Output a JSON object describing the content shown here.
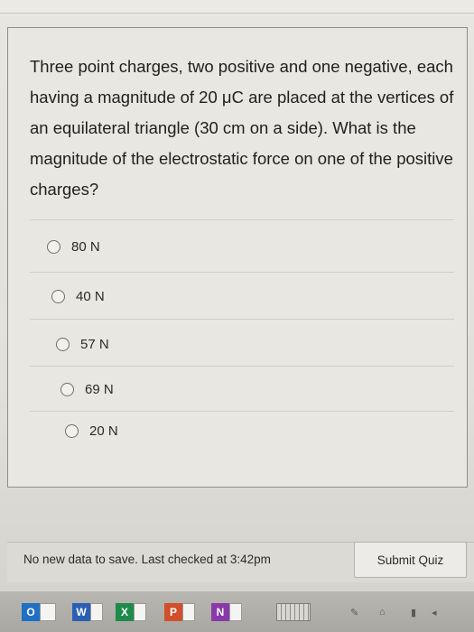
{
  "question": {
    "text": "Three point charges, two positive and one negative, each having a magnitude of 20 μC are placed at the vertices of an equilateral triangle (30 cm on a side). What is the magnitude of the electrostatic force on one of the positive charges?"
  },
  "options": [
    {
      "label": "80 N",
      "selected": false
    },
    {
      "label": "40 N",
      "selected": false
    },
    {
      "label": "57 N",
      "selected": false
    },
    {
      "label": "69 N",
      "selected": false
    },
    {
      "label": "20 N",
      "selected": false
    }
  ],
  "footer": {
    "status": "No new data to save. Last checked at 3:42pm",
    "submit_label": "Submit Quiz"
  },
  "taskbar": {
    "apps": [
      {
        "name": "outlook-icon",
        "letter": "O",
        "color": "#1f6fc5"
      },
      {
        "name": "word-icon",
        "letter": "W",
        "color": "#2b5fb3"
      },
      {
        "name": "excel-icon",
        "letter": "X",
        "color": "#1f8a4c"
      },
      {
        "name": "powerpoint-icon",
        "letter": "P",
        "color": "#d14f2b"
      },
      {
        "name": "onenote-icon",
        "letter": "N",
        "color": "#8a3aa8"
      }
    ]
  }
}
